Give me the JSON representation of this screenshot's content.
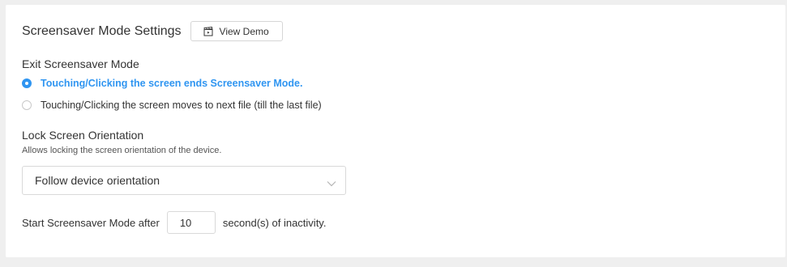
{
  "header": {
    "title": "Screensaver Mode Settings",
    "demo_button_label": "View Demo",
    "demo_icon": "clapperboard-icon"
  },
  "exit_mode": {
    "label": "Exit Screensaver Mode",
    "options": [
      {
        "label": "Touching/Clicking the screen ends Screensaver Mode.",
        "selected": true
      },
      {
        "label": "Touching/Clicking the screen moves to next file (till the last file)",
        "selected": false
      }
    ]
  },
  "orientation": {
    "label": "Lock Screen Orientation",
    "helper": "Allows locking the screen orientation of the device.",
    "selected_value": "Follow device orientation",
    "chevron_icon": "chevron-down-icon"
  },
  "timeout": {
    "prefix": "Start Screensaver Mode after",
    "value": "10",
    "suffix": "second(s) of inactivity."
  },
  "colors": {
    "accent": "#2f95f1",
    "background": "#efefef",
    "panel": "#ffffff"
  }
}
